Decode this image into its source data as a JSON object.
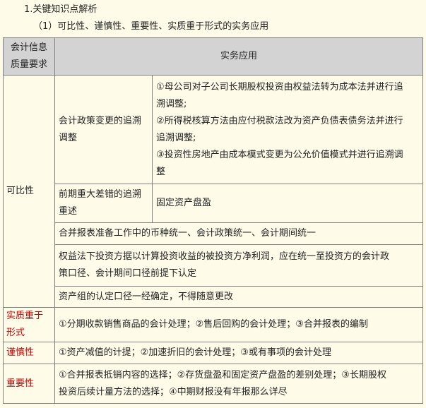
{
  "headings": {
    "h1": "1.关键知识点解析",
    "h2": "（1）可比性、谨慎性、重要性、实质重于形式的实务应用"
  },
  "table": {
    "header": {
      "category_line1": "会计信息",
      "category_line2": "质量要求",
      "application": "实务应用"
    },
    "comparability": {
      "category": "可比性",
      "policy_change": {
        "label_line1": "会计政策变更的追溯",
        "label_line2": "调整",
        "item1_line1": "①母公司对子公司长期股权投资由权益法转为成本法并进行追",
        "item1_line2": "溯调整;",
        "item2_line1": "②所得税核算方法由应付税款法改为资产负债表债务法并进行",
        "item2_line2": "追溯调整;",
        "item3_line1": "③投资性房地产由成本模式变更为公允价值模式并进行追溯调",
        "item3_line2": "整"
      },
      "error_correction": {
        "label_line1": "前期重大差错的追溯",
        "label_line2": "重述",
        "value": "固定资产盘盈"
      },
      "consolidation_prep": "合并报表准备工作中的币种统一、会计政策统一、会计期间统一",
      "equity_method_line1": "权益法下投资方据以计算投资收益的被投资方净利润，应在统一至投资方的会计政",
      "equity_method_line2": "策口径、会计期间口径前提下认定",
      "asset_group": "资产组的认定口径一经确定，不得随意更改"
    },
    "substance": {
      "category_line1": "实质重于",
      "category_line2": "形式",
      "value": "①分期收款销售商品的会计处理；②售后回购的会计处理；③合并报表的编制"
    },
    "prudence": {
      "category": "谨慎性",
      "value": "①资产减值的计提；②加速折旧的会计处理；③或有事项的会计处理"
    },
    "materiality": {
      "category": "重要性",
      "value_line1": "①合并报表抵销内容的选择；②存货盘盈和固定资产盘盈的差别处理；③长期股权",
      "value_line2": "投资后续计量方法的选择；④中期财报没有年报那么详尽"
    }
  }
}
